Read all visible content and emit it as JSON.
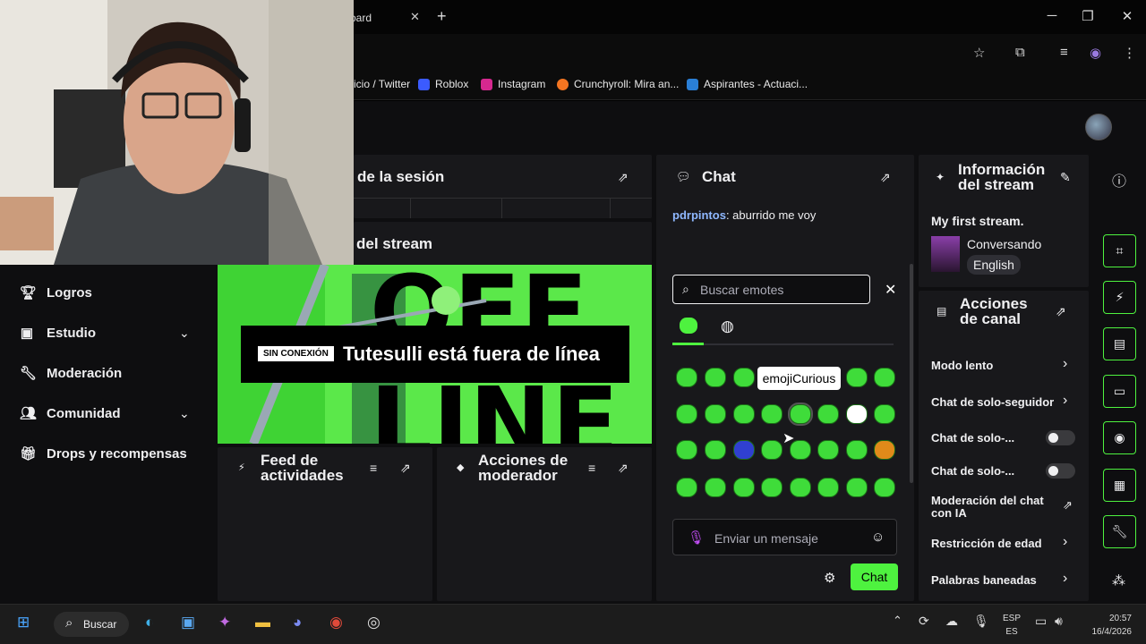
{
  "browser": {
    "active_tab_title": "oard",
    "bookmarks": [
      "icio / Twitter",
      "Roblox",
      "Instagram",
      "Crunchyroll: Mira an...",
      "Aspirantes - Actuaci..."
    ]
  },
  "nav": {
    "items": [
      {
        "label": "Logros",
        "icon": "trophy-icon"
      },
      {
        "label": "Estudio",
        "icon": "film-icon"
      },
      {
        "label": "Moderación",
        "icon": "wrench-icon"
      },
      {
        "label": "Comunidad",
        "icon": "community-icon"
      },
      {
        "label": "Drops y recompensas",
        "icon": "gift-icon"
      }
    ]
  },
  "session": {
    "title": "de la sesión"
  },
  "stream": {
    "title": "del stream"
  },
  "preview": {
    "badge": "SIN CONEXIÓN",
    "offline_text": "Tutesulli está fuera de línea"
  },
  "feed": {
    "title_line1": "Feed de",
    "title_line2": "actividades"
  },
  "modact": {
    "title_line1": "Acciones de",
    "title_line2": "moderador"
  },
  "chat": {
    "title": "Chat",
    "message_user": "pdrpintos",
    "message_text": ": aburrido me voy",
    "emote_search_placeholder": "Buscar emotes",
    "tooltip": "emojiCurious",
    "input_placeholder": "Enviar un mensaje",
    "send_label": "Chat"
  },
  "info": {
    "title_line1": "Información",
    "title_line2": "del stream",
    "stream_title": "My first stream.",
    "category": "Conversando",
    "language": "English"
  },
  "acciones": {
    "title_line1": "Acciones",
    "title_line2": "de canal",
    "rows": [
      "Modo lento",
      "Chat de solo-seguidor",
      "Chat de solo-...",
      "Chat de solo-...",
      "Moderación del chat",
      "con IA",
      "Restricción de edad",
      "Palabras baneadas"
    ]
  },
  "taskbar": {
    "search": "Buscar",
    "lang1": "ESP",
    "lang2": "ES",
    "time": "20:57",
    "date": "16/4/2026"
  },
  "colors": {
    "accent": "#4ef23f",
    "panel": "#18181b",
    "page": "#0e0e10"
  }
}
